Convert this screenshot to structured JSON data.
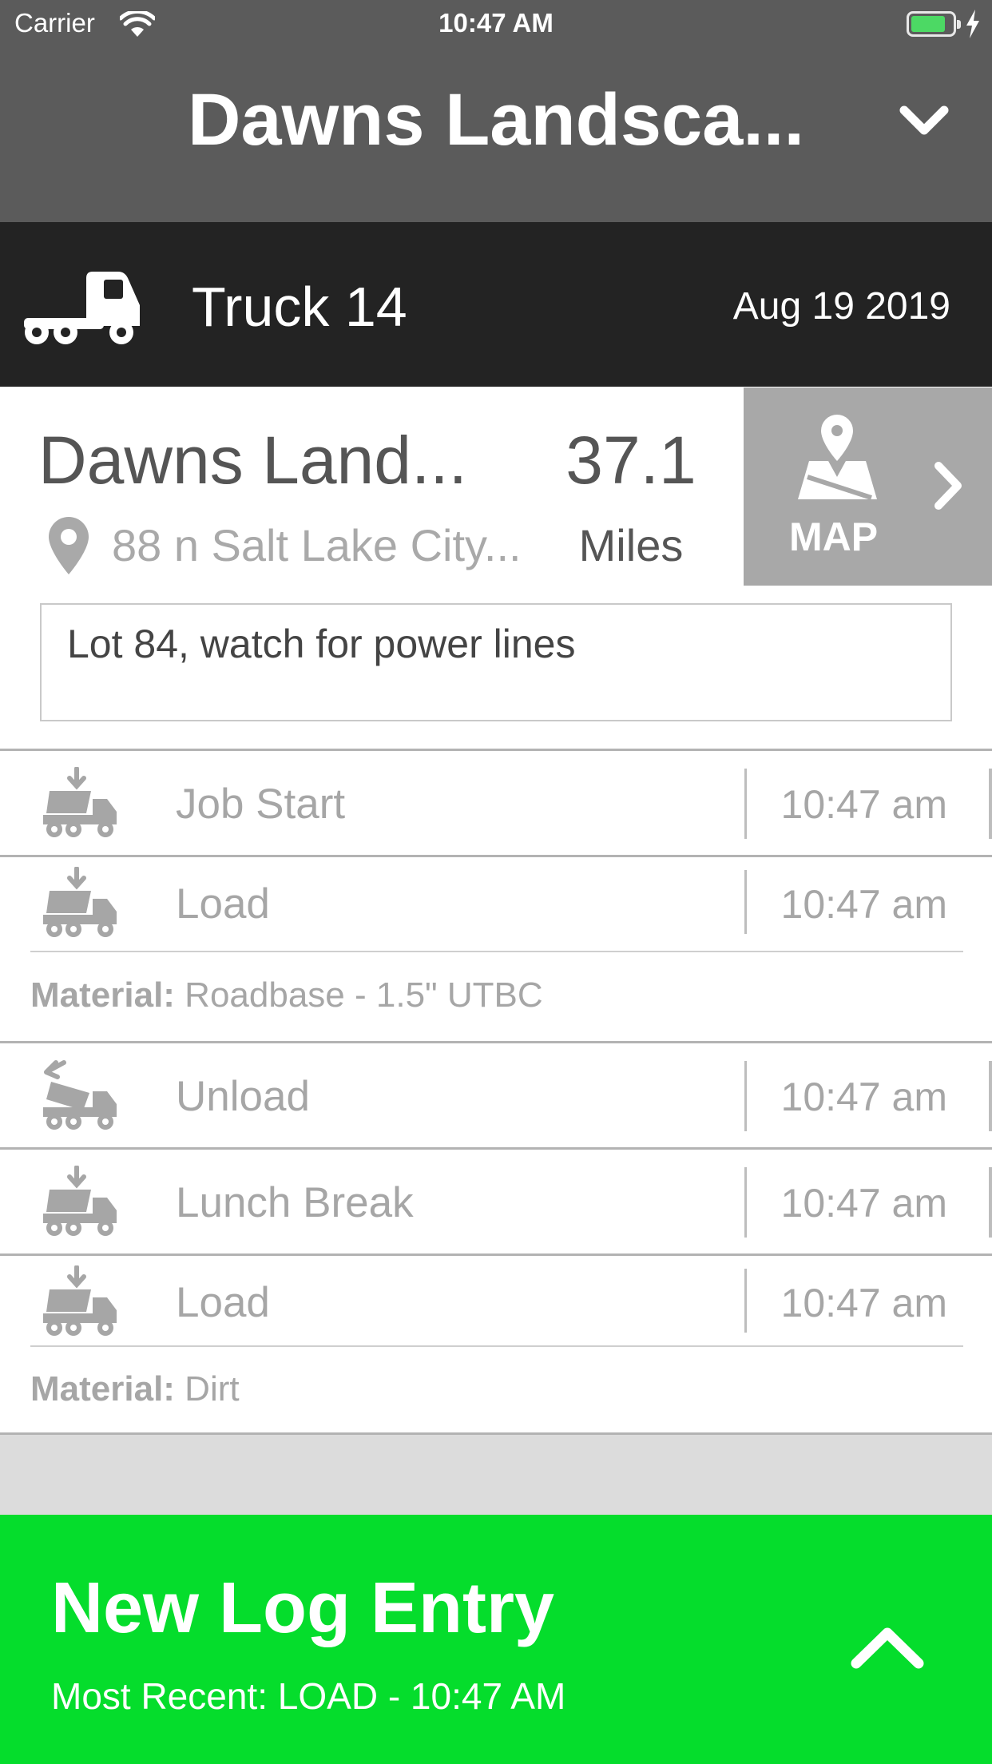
{
  "status_bar": {
    "carrier": "Carrier",
    "time": "10:47 AM",
    "battery_color": "#4cd964"
  },
  "header": {
    "title": "Dawns Landsca...",
    "dropdown_icon": "chevron-down-icon",
    "background": "#5b5b5b"
  },
  "truck": {
    "name": "Truck 14",
    "date": "Aug 19 2019",
    "icon": "truck-icon",
    "background": "#232323"
  },
  "job": {
    "name": "Dawns Land...",
    "address": "88 n Salt Lake City...",
    "distance_value": "37.1",
    "distance_unit": "Miles",
    "map_label": "MAP",
    "notes": "Lot 84, watch for power lines"
  },
  "log_entries": [
    {
      "label": "Job Start",
      "time": "10:47 am",
      "icon": "truck-load-icon"
    },
    {
      "label": "Load",
      "time": "10:47 am",
      "icon": "truck-load-icon",
      "material_key": "Material:",
      "material_value": " Roadbase - 1.5\" UTBC"
    },
    {
      "label": "Unload",
      "time": "10:47 am",
      "icon": "truck-unload-icon"
    },
    {
      "label": "Lunch Break",
      "time": "10:47 am",
      "icon": "truck-load-icon"
    },
    {
      "label": "Load",
      "time": "10:47 am",
      "icon": "truck-load-icon",
      "material_key": "Material:",
      "material_value": " Dirt"
    }
  ],
  "new_entry": {
    "title": "New Log Entry",
    "most_recent": "Most Recent: LOAD - 10:47 AM",
    "icon": "chevron-up-icon",
    "background": "#05dd2c"
  }
}
